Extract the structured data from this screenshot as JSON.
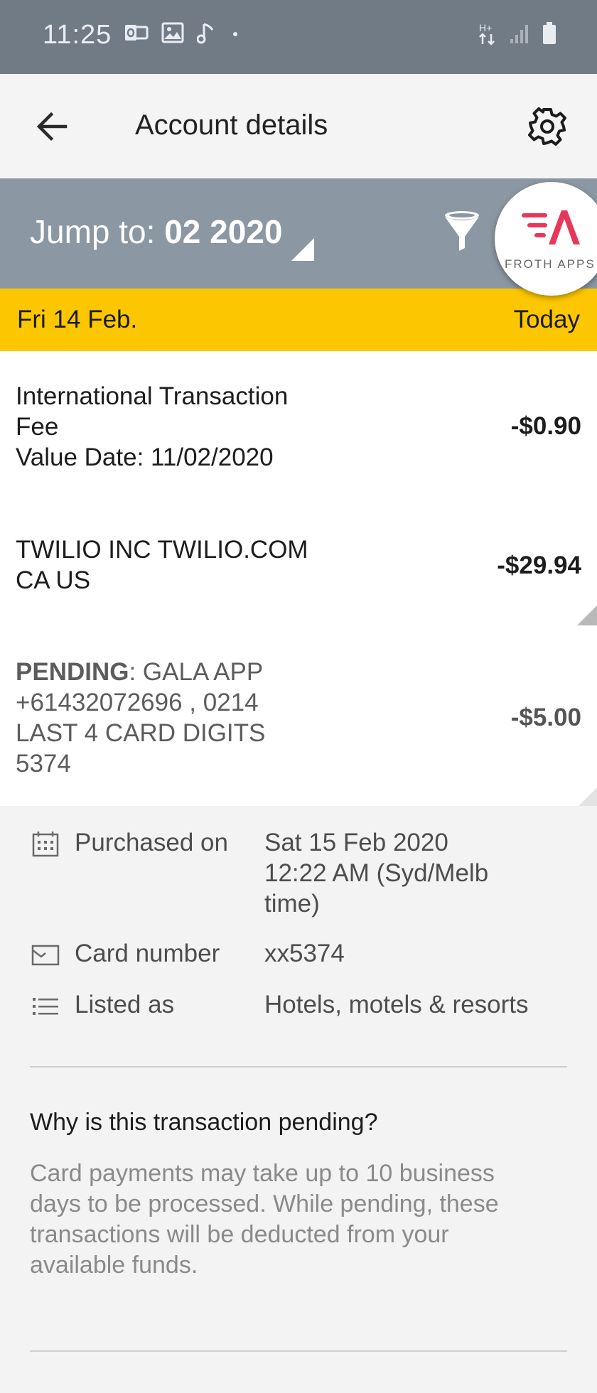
{
  "status_bar": {
    "time": "11:25",
    "left_icons": [
      "outlook-icon",
      "image-icon",
      "music-note-icon",
      "dot-icon"
    ],
    "right_icons": [
      "hplus-data-icon",
      "signal-icon",
      "battery-icon"
    ],
    "network_label": "H+"
  },
  "app_bar": {
    "title": "Account details",
    "back_icon": "arrow-left-icon",
    "settings_icon": "gear-icon"
  },
  "jump_bar": {
    "prefix": "Jump to: ",
    "value": "02 2020",
    "filter_icon": "filter-icon"
  },
  "brand_badge": {
    "text": "FROTH APPS",
    "accent": "#e8375a"
  },
  "date_header": {
    "left": "Fri 14 Feb.",
    "right": "Today",
    "color": "#fcc700"
  },
  "transactions": [
    {
      "line1": "International Transaction",
      "line2": "Fee",
      "line3": "Value Date: 11/02/2020",
      "amount": "-$0.90"
    },
    {
      "line1": "TWILIO INC TWILIO.COM",
      "line2": "CA US",
      "amount": "-$29.94"
    },
    {
      "status": "PENDING",
      "line1_rest": ": GALA APP",
      "line2": "+61432072696 , 0214",
      "line3": "LAST 4 CARD DIGITS",
      "line4": "5374",
      "amount": "-$5.00"
    }
  ],
  "details": {
    "purchased_label": "Purchased on",
    "purchased_value_1": "Sat 15 Feb 2020",
    "purchased_value_2": "12:22 AM (Syd/Melb",
    "purchased_value_3": "time)",
    "card_label": "Card number",
    "card_value": "xx5374",
    "listed_label": "Listed as",
    "listed_value": "Hotels, motels & resorts",
    "faq_question": "Why is this transaction pending?",
    "faq_answer_1": "Card payments may take up to 10 business",
    "faq_answer_2": "days to be processed. While pending, these",
    "faq_answer_3": "transactions will be deducted from your",
    "faq_answer_4": "available funds."
  }
}
